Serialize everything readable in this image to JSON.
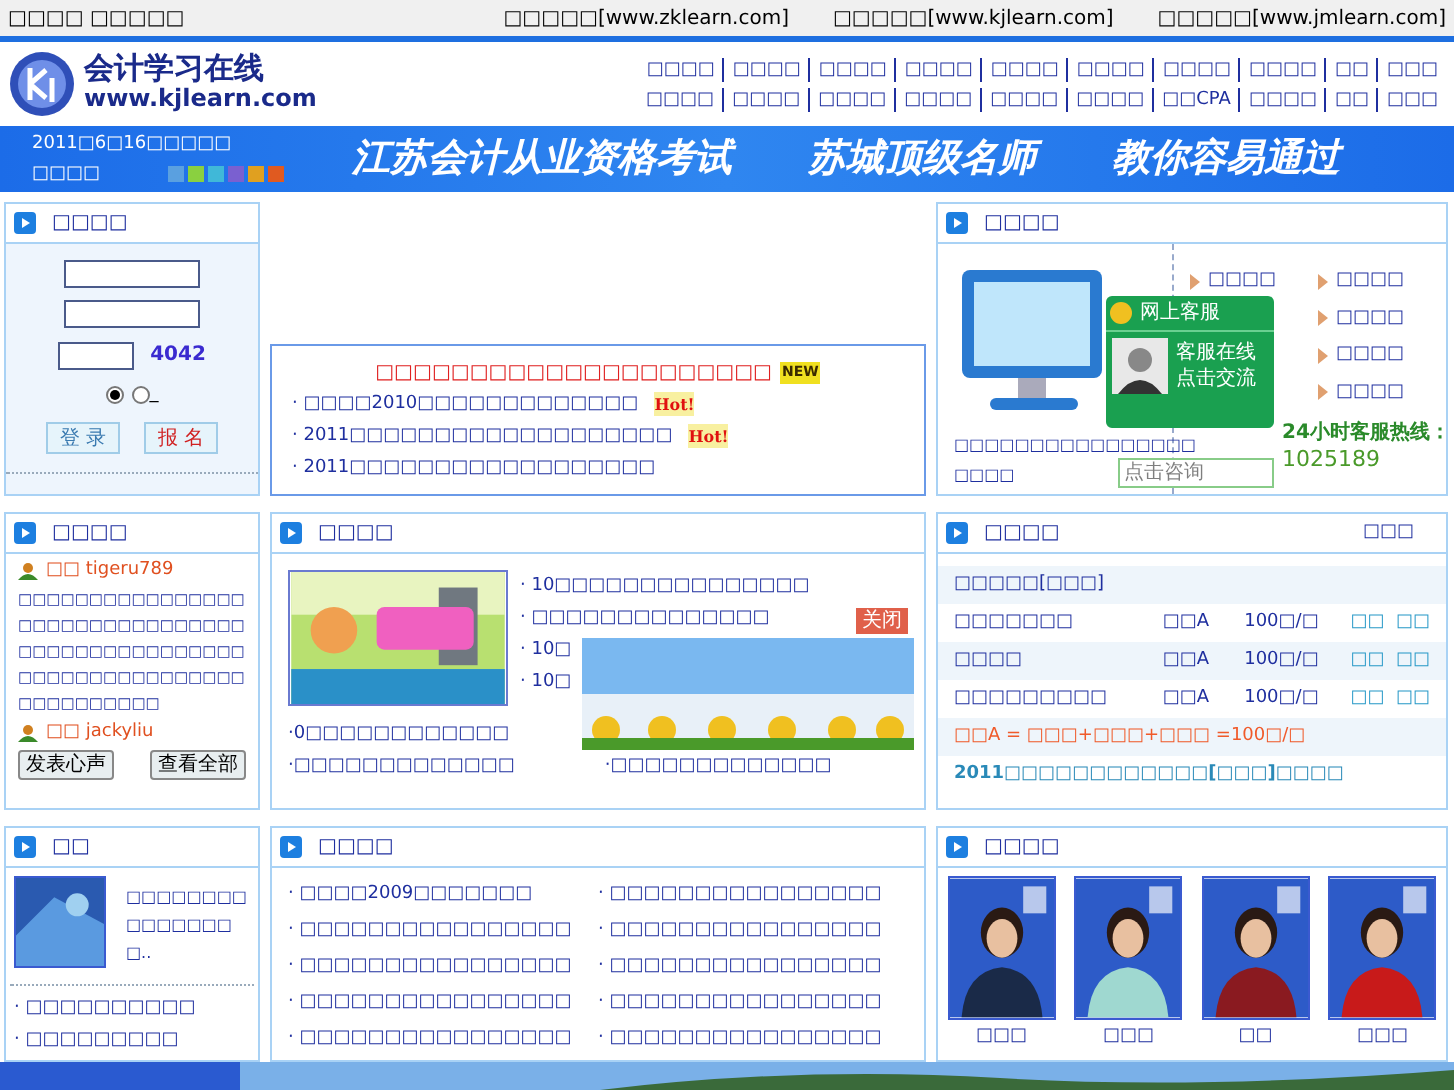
{
  "top_bar": {
    "left": "□□□□ □□□□□",
    "links": [
      "□□□□□[www.zklearn.com]",
      "□□□□□[www.kjlearn.com]",
      "□□□□□[www.jmlearn.com]"
    ]
  },
  "logo": {
    "name": "会计学习在线",
    "url": "www.kjlearn.com"
  },
  "nav": [
    [
      "□□□□",
      "□□□□",
      "□□□□",
      "□□□□",
      "□□□□",
      "□□□□",
      "□□□□",
      "□□□□",
      "□□",
      "□□□"
    ],
    [
      "□□□□",
      "□□□□",
      "□□□□",
      "□□□□",
      "□□□□",
      "□□□□",
      "□□CPA",
      "□□□□",
      "□□",
      "□□□"
    ]
  ],
  "banner": {
    "date": "2011□6□16□□□□□",
    "label": "□□□□",
    "slogan": [
      "江苏会计从业资格考试",
      "苏城顶级名师",
      "教你容易通过"
    ]
  },
  "login": {
    "title": "□□□□",
    "captcha": "4042",
    "roles": [
      {
        "selected": true
      },
      {
        "label": "_",
        "selected": false
      }
    ],
    "buttons": [
      "登 录",
      "报 名"
    ]
  },
  "notice": {
    "title": "□□□□□□□□□□□□□□□□□□□□□",
    "badge": "NEW",
    "items": [
      {
        "text": "· □□□□2010□□□□□□□□□□□□□",
        "badge": "Hot!"
      },
      {
        "text": "· 2011□□□□□□□□□□□□□□□□□□□",
        "badge": "Hot!"
      },
      {
        "text": "· 2011□□□□□□□□□□□□□□□□□□"
      }
    ]
  },
  "service": {
    "title": "□□□□",
    "links": [
      "□□□□",
      "□□□□",
      "□□□□",
      "□□□□",
      "□□□□"
    ],
    "caption": [
      "□□□□□□□□□□□□□□□□",
      "□□□□"
    ],
    "widget": {
      "title": "网上客服",
      "lines": [
        "客服在线",
        "点击交流"
      ],
      "placeholder": "点击咨询"
    },
    "hotline_label": "24小时客服热线：",
    "hotline": "1025189"
  },
  "messages": {
    "title": "□□□□",
    "posts": [
      {
        "user": "□□ tigeru789",
        "text": "□□□□□□□□□□□□□□□□□□□□□□□□□□□□□□□□□□□□□□□□□□□□□□□□□□□□□□□□□□□□□□□□□□□□□□□□□□"
      },
      {
        "user": "□□ jackyliu"
      }
    ],
    "buttons": [
      "发表心声",
      "查看全部"
    ]
  },
  "news": {
    "title": "□□□□",
    "items": [
      "· 10□□□□□□□□□□□□□□□",
      "· □□□□□□□□□□□□□□",
      "· 10□",
      "· 10□"
    ],
    "bottom": [
      "·0□□□□□□□□□□□□",
      "·□□□□□□□□□□□□□",
      "·□□□□□□□□□□□□□"
    ],
    "close": "关闭"
  },
  "prices": {
    "title": "□□□□",
    "header": "□□□",
    "rows": [
      {
        "kind": "heading",
        "cells": [
          "□□□□□[□□□]"
        ]
      },
      {
        "kind": "item",
        "cells": [
          "□□□□□□□",
          "□□A",
          "100□/□",
          "□□",
          "□□"
        ]
      },
      {
        "kind": "item",
        "cells": [
          "□□□□",
          "□□A",
          "100□/□",
          "□□",
          "□□"
        ]
      },
      {
        "kind": "item",
        "cells": [
          "□□□□□□□□□",
          "□□A",
          "100□/□",
          "□□",
          "□□"
        ]
      },
      {
        "kind": "formula",
        "cells": [
          "□□A = □□□+□□□+□□□ =100□/□"
        ]
      },
      {
        "kind": "notice",
        "cells": [
          "2011□□□□□□□□□□□□[□□□]□□□□"
        ]
      }
    ]
  },
  "guide": {
    "title": "□□",
    "text": "□□□□□□□□□□□□□□□□..",
    "items": [
      "· □□□□□□□□□□",
      "· □□□□□□□□□"
    ]
  },
  "articles": {
    "title": "□□□□",
    "items": [
      "· □□□□2009□□□□□□□",
      "· □□□□□□□□□□□□□□□□",
      "· □□□□□□□□□□□□□□□□",
      "· □□□□□□□□□□□□□□□□",
      "· □□□□□□□□□□□□□□□□",
      "· □□□□□□□□□□□□□□□□",
      "· □□□□□□□□□□□□□□□□",
      "· □□□□□□□□□□□□□□□□",
      "· □□□□□□□□□□□□□□□□",
      "· □□□□□□□□□□□□□□□□"
    ]
  },
  "teachers": {
    "title": "□□□□",
    "people": [
      {
        "name": "□□□"
      },
      {
        "name": "□□□"
      },
      {
        "name": "□□"
      },
      {
        "name": "□□□"
      }
    ]
  }
}
